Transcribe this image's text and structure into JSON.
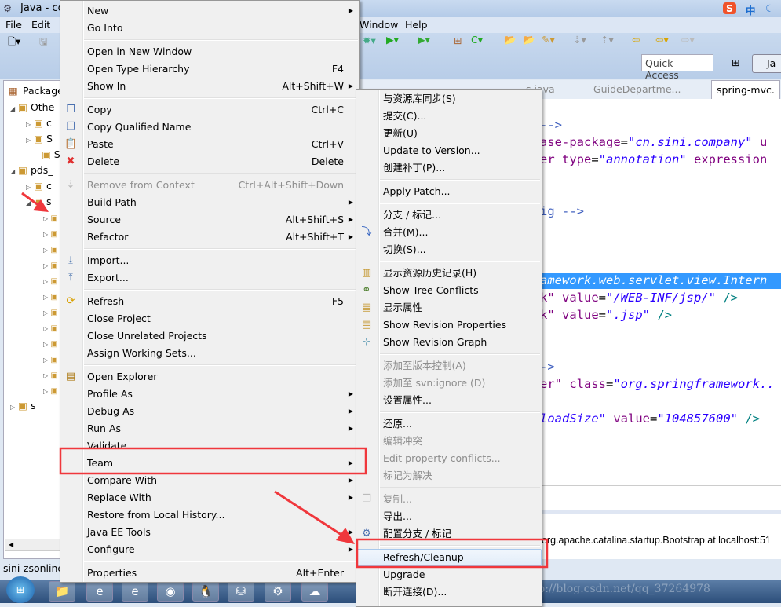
{
  "window": {
    "title": "Java - co"
  },
  "menubar": [
    "File",
    "Edit",
    "Window",
    "Help"
  ],
  "toolbar": {
    "quick_access": "Quick Access",
    "perspective": "Ja"
  },
  "package_explorer": {
    "title": "Package",
    "items": [
      "Othe",
      "c",
      "S",
      "S",
      "pds_",
      "c",
      "s",
      "s"
    ]
  },
  "editor_tabs": [
    "s.java",
    "GuideDepartme...",
    "spring-mvc."
  ],
  "code": [
    {
      "parts": [
        [
          "cm",
          "-->"
        ]
      ]
    },
    {
      "parts": [
        [
          "at",
          "ase-package"
        ],
        [
          "",
          "="
        ],
        [
          "st",
          "\"cn.sini.company\""
        ],
        [
          "at",
          " u"
        ]
      ]
    },
    {
      "parts": [
        [
          "at",
          "er type"
        ],
        [
          "",
          "="
        ],
        [
          "st",
          "\"annotation\""
        ],
        [
          "at",
          " expression"
        ]
      ]
    },
    {
      "parts": [
        [
          "cm",
          "ig -->"
        ]
      ]
    },
    {
      "parts": [
        [
          "at",
          "k\" value"
        ],
        [
          "",
          "="
        ],
        [
          "st",
          "\"/WEB-INF/jsp/\""
        ],
        [
          "tg",
          " />"
        ]
      ]
    },
    {
      "parts": [
        [
          "at",
          "k\" value"
        ],
        [
          "",
          "="
        ],
        [
          "st",
          "\".jsp\""
        ],
        [
          "tg",
          " />"
        ]
      ]
    },
    {
      "parts": [
        [
          "cm",
          "->"
        ]
      ]
    },
    {
      "parts": [
        [
          "at",
          "er\" class"
        ],
        [
          "",
          "="
        ],
        [
          "st",
          "\"org.springframework.."
        ]
      ]
    },
    {
      "parts": [
        [
          "st",
          "loadSize\""
        ],
        [
          "at",
          " value"
        ],
        [
          "",
          "="
        ],
        [
          "st",
          "\"104857600\""
        ],
        [
          "tg",
          " />"
        ]
      ]
    }
  ],
  "selected_code": "amework.web.servlet.view.Intern",
  "console": "org.apache.catalina.startup.Bootstrap at localhost:51",
  "status": "sini-zsonline",
  "ime": {
    "logo": "S",
    "mode": "中"
  },
  "context_menu": [
    {
      "label": "New",
      "arrow": true
    },
    {
      "label": "Go Into"
    },
    {
      "sep": true
    },
    {
      "label": "Open in New Window"
    },
    {
      "label": "Open Type Hierarchy",
      "shortcut": "F4"
    },
    {
      "label": "Show In",
      "shortcut": "Alt+Shift+W",
      "arrow": true
    },
    {
      "sep": true
    },
    {
      "label": "Copy",
      "shortcut": "Ctrl+C",
      "icon": "copy-icon"
    },
    {
      "label": "Copy Qualified Name",
      "icon": "copy-qualified-icon"
    },
    {
      "label": "Paste",
      "shortcut": "Ctrl+V",
      "icon": "paste-icon"
    },
    {
      "label": "Delete",
      "shortcut": "Delete",
      "icon": "delete-icon"
    },
    {
      "sep": true
    },
    {
      "label": "Remove from Context",
      "shortcut": "Ctrl+Alt+Shift+Down",
      "disabled": true,
      "icon": "remove-context-icon"
    },
    {
      "label": "Build Path",
      "arrow": true
    },
    {
      "label": "Source",
      "shortcut": "Alt+Shift+S",
      "arrow": true
    },
    {
      "label": "Refactor",
      "shortcut": "Alt+Shift+T",
      "arrow": true
    },
    {
      "sep": true
    },
    {
      "label": "Import...",
      "icon": "import-icon"
    },
    {
      "label": "Export...",
      "icon": "export-icon"
    },
    {
      "sep": true
    },
    {
      "label": "Refresh",
      "shortcut": "F5",
      "icon": "refresh-icon"
    },
    {
      "label": "Close Project"
    },
    {
      "label": "Close Unrelated Projects"
    },
    {
      "label": "Assign Working Sets..."
    },
    {
      "sep": true
    },
    {
      "label": "Open Explorer",
      "icon": "explorer-icon"
    },
    {
      "label": "Profile As",
      "arrow": true
    },
    {
      "label": "Debug As",
      "arrow": true
    },
    {
      "label": "Run As",
      "arrow": true
    },
    {
      "label": "Validate"
    },
    {
      "label": "Team",
      "arrow": true
    },
    {
      "label": "Compare With",
      "arrow": true
    },
    {
      "label": "Replace With",
      "arrow": true
    },
    {
      "label": "Restore from Local History..."
    },
    {
      "label": "Java EE Tools",
      "arrow": true
    },
    {
      "label": "Configure",
      "arrow": true
    },
    {
      "sep": true
    },
    {
      "label": "Properties",
      "shortcut": "Alt+Enter"
    }
  ],
  "team_submenu": [
    {
      "label": "与资源库同步(S)"
    },
    {
      "label": "提交(C)..."
    },
    {
      "label": "更新(U)"
    },
    {
      "label": "Update to Version..."
    },
    {
      "label": "创建补丁(P)..."
    },
    {
      "sep": true
    },
    {
      "label": "Apply Patch..."
    },
    {
      "sep": true
    },
    {
      "label": "分支 / 标记..."
    },
    {
      "label": "合并(M)...",
      "icon": "merge-icon"
    },
    {
      "label": "切换(S)..."
    },
    {
      "sep": true
    },
    {
      "label": "显示资源历史记录(H)",
      "icon": "history-icon"
    },
    {
      "label": "Show Tree Conflicts",
      "icon": "tree-conflicts-icon"
    },
    {
      "label": "显示属性",
      "icon": "properties-icon"
    },
    {
      "label": "Show Revision Properties",
      "icon": "revision-properties-icon"
    },
    {
      "label": "Show Revision Graph",
      "icon": "revision-graph-icon"
    },
    {
      "sep": true
    },
    {
      "label": "添加至版本控制(A)",
      "disabled": true
    },
    {
      "label": "添加至 svn:ignore (D)",
      "disabled": true
    },
    {
      "label": "设置属性..."
    },
    {
      "sep": true
    },
    {
      "label": "还原..."
    },
    {
      "label": "编辑冲突",
      "disabled": true
    },
    {
      "label": "Edit property conflicts...",
      "disabled": true
    },
    {
      "label": "标记为解决",
      "disabled": true
    },
    {
      "sep": true
    },
    {
      "label": "复制...",
      "disabled": true,
      "icon": "copy-icon"
    },
    {
      "label": "导出..."
    },
    {
      "label": "配置分支 / 标记",
      "icon": "configure-branch-icon"
    },
    {
      "sep": true
    },
    {
      "label": "Refresh/Cleanup",
      "hovered": true
    },
    {
      "label": "Upgrade"
    },
    {
      "label": "断开连接(D)..."
    }
  ],
  "watermark": "http://blog.csdn.net/qq_37264978",
  "annotation_color": "#f0373c"
}
